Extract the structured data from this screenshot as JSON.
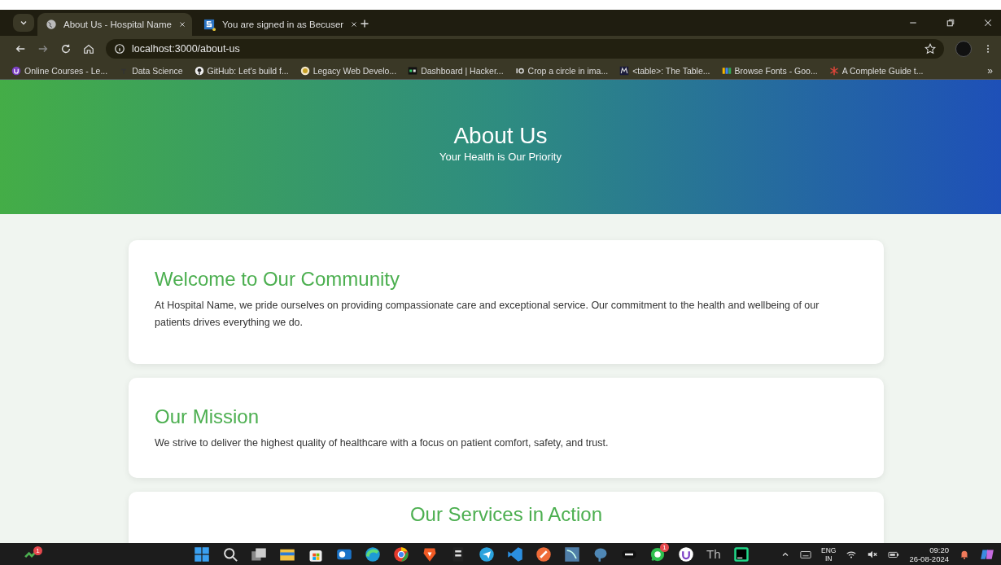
{
  "tabs": [
    {
      "title": "About Us - Hospital Name",
      "selected": true
    },
    {
      "title": "You are signed in as Becuser",
      "selected": false
    }
  ],
  "address": "localhost:3000/about-us",
  "bookmarks": [
    "Online Courses - Le...",
    "Data Science",
    "GitHub: Let's build f...",
    "Legacy Web Develo...",
    "Dashboard | Hacker...",
    "Crop a circle in ima...",
    "<table>: The Table...",
    "Browse Fonts - Goo...",
    "A Complete Guide t..."
  ],
  "bookmarks_overflow": "»",
  "hero": {
    "title": "About Us",
    "subtitle": "Your Health is Our Priority"
  },
  "sections": [
    {
      "heading": "Welcome to Our Community",
      "text": "At Hospital Name, we pride ourselves on providing compassionate care and exceptional service. Our commitment to the health and wellbeing of our patients drives everything we do."
    },
    {
      "heading": "Our Mission",
      "text": "We strive to deliver the highest quality of healthcare with a focus on patient comfort, safety, and trust."
    },
    {
      "heading": "Our Services in Action"
    }
  ],
  "taskbar": {
    "widget_badge": "1",
    "chat_badge": "1",
    "app_label": "Th",
    "language": "ENG",
    "region": "IN",
    "time": "09:20",
    "date": "26-08-2024"
  }
}
